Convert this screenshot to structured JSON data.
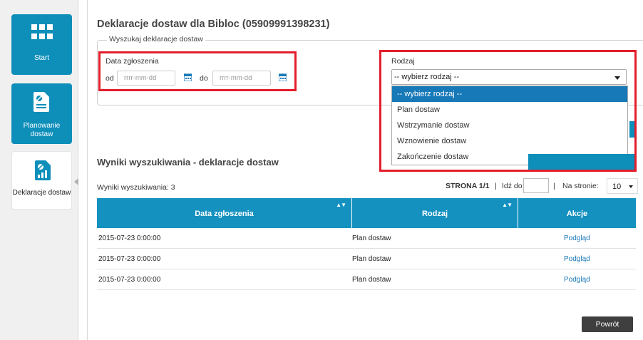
{
  "sidebar": {
    "items": [
      {
        "label": "Start",
        "icon": "grid-icon"
      },
      {
        "label": "Planowanie dostaw",
        "icon": "document-icon"
      },
      {
        "label": "Deklaracje dostaw",
        "icon": "chart-document-icon"
      }
    ]
  },
  "page": {
    "title": "Deklaracje dostaw dla Bibloc (05909991398231)"
  },
  "search": {
    "legend": "Wyszukaj deklaracje dostaw",
    "date_label": "Data zgłoszenia",
    "from_label": "od",
    "to_label": "do",
    "from_placeholder": "rrrr-mm-dd",
    "to_placeholder": "rrrr-mm-dd",
    "type_label": "Rodzaj",
    "type_selected": "-- wybierz rodzaj --",
    "type_options": [
      "-- wybierz rodzaj --",
      "Plan dostaw",
      "Wstrzymanie dostaw",
      "Wznowienie dostaw",
      "Zakończenie dostaw"
    ]
  },
  "results": {
    "title": "Wyniki wyszukiwania - deklaracje dostaw",
    "count_text": "Wyniki wyszukiwania: 3",
    "page_text": "STRONA 1/1",
    "goto_label": "Idź do",
    "per_page_label": "Na stronie:",
    "per_page_value": "10",
    "columns": [
      "Data zgłoszenia",
      "Rodzaj",
      "Akcje"
    ],
    "rows": [
      {
        "date": "2015-07-23 0:00:00",
        "type": "Plan dostaw",
        "action": "Podgląd"
      },
      {
        "date": "2015-07-23 0:00:00",
        "type": "Plan dostaw",
        "action": "Podgląd"
      },
      {
        "date": "2015-07-23 0:00:00",
        "type": "Plan dostaw",
        "action": "Podgląd"
      }
    ]
  },
  "footer": {
    "back_label": "Powrót"
  },
  "colors": {
    "accent": "#0e8fba",
    "table_header": "#1591c0",
    "highlight_red": "#e41e2b",
    "link": "#1879b8"
  }
}
